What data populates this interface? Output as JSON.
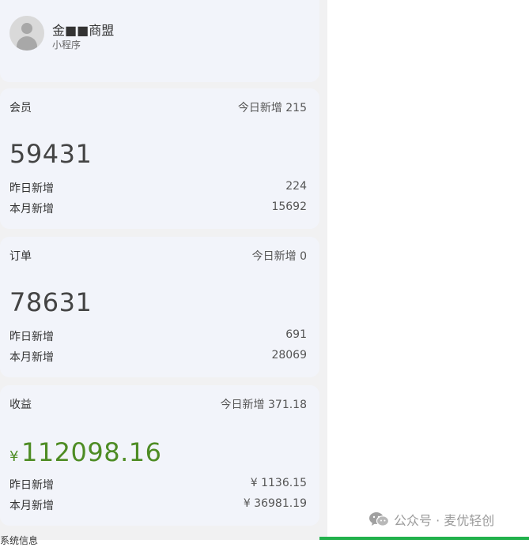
{
  "header": {
    "app_name": "金■■商盟",
    "app_type": "小程序"
  },
  "members": {
    "title": "会员",
    "today_label": "今日新增 215",
    "total": "59431",
    "rows": [
      {
        "label": "昨日新增",
        "value": "224"
      },
      {
        "label": "本月新增",
        "value": "15692"
      }
    ]
  },
  "orders": {
    "title": "订单",
    "today_label": "今日新增 0",
    "total": "78631",
    "rows": [
      {
        "label": "昨日新增",
        "value": "691"
      },
      {
        "label": "本月新增",
        "value": "28069"
      }
    ]
  },
  "income": {
    "title": "收益",
    "today_label": "今日新增 371.18",
    "currency": "¥",
    "total": "112098.16",
    "rows": [
      {
        "label": "昨日新增",
        "value": "¥ 1136.15"
      },
      {
        "label": "本月新增",
        "value": "¥ 36981.19"
      }
    ],
    "accent_color": "#4e8c24"
  },
  "footer_partial_text": "系统信息",
  "watermark": {
    "text": "公众号 · 麦优轻创",
    "icon": "wechat-icon"
  }
}
